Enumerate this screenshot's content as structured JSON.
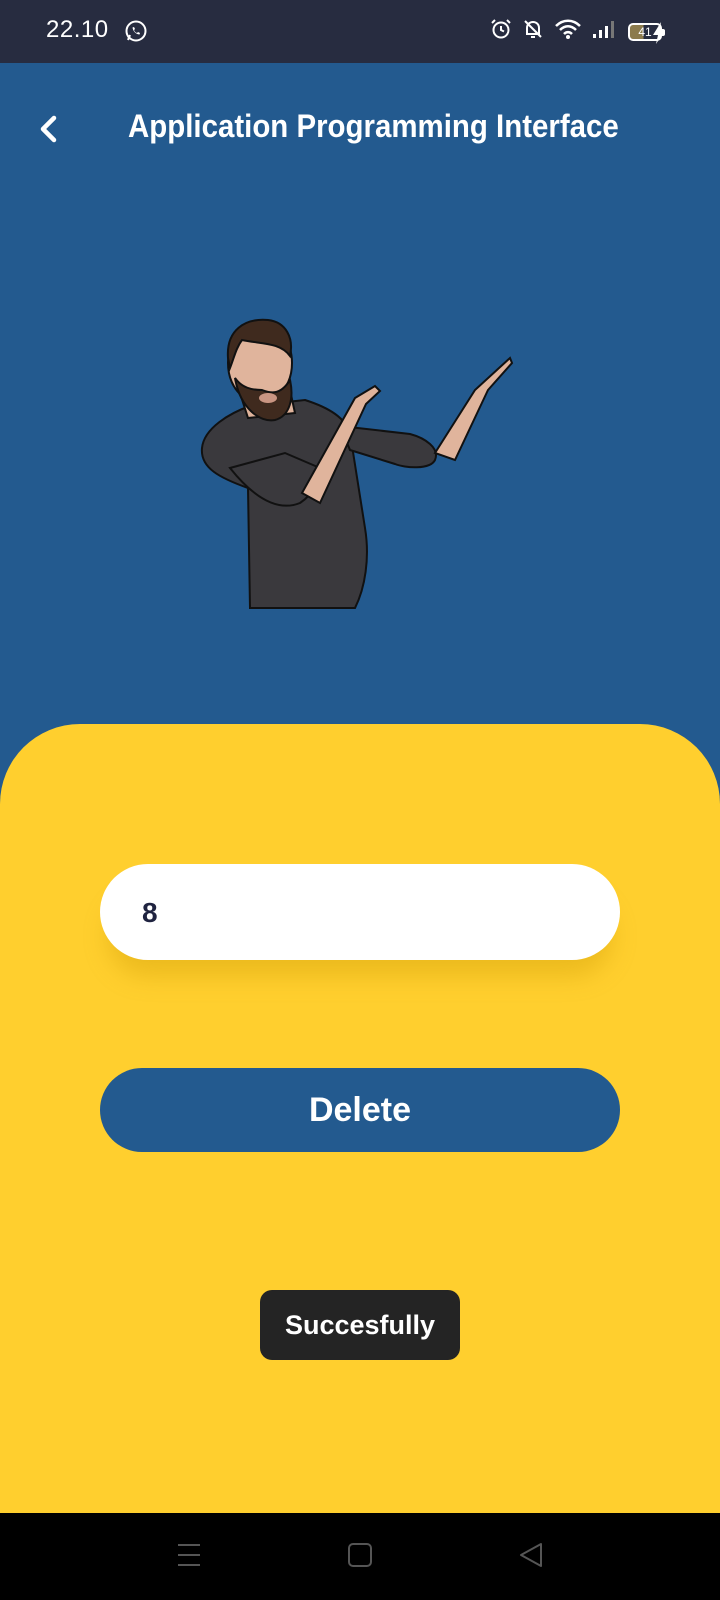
{
  "status_bar": {
    "time": "22.10",
    "battery_level": "41",
    "icons": [
      "whatsapp-icon",
      "alarm-icon",
      "bell-off-icon",
      "wifi-icon",
      "signal-icon",
      "battery-icon",
      "charging-icon"
    ]
  },
  "header": {
    "title": "Application Programming Interface",
    "back_icon": "chevron-left-icon"
  },
  "illustration": {
    "name": "man-pointing-illustration"
  },
  "form": {
    "id_input_value": "8",
    "delete_label": "Delete"
  },
  "toast": {
    "message": "Succesfully"
  },
  "nav_bar": {
    "icons": [
      "menu-icon",
      "home-square-icon",
      "back-triangle-icon"
    ]
  },
  "colors": {
    "primary": "#235a8f",
    "panel": "#ffcf2e",
    "status_bar": "#272c40",
    "toast": "#242424"
  }
}
